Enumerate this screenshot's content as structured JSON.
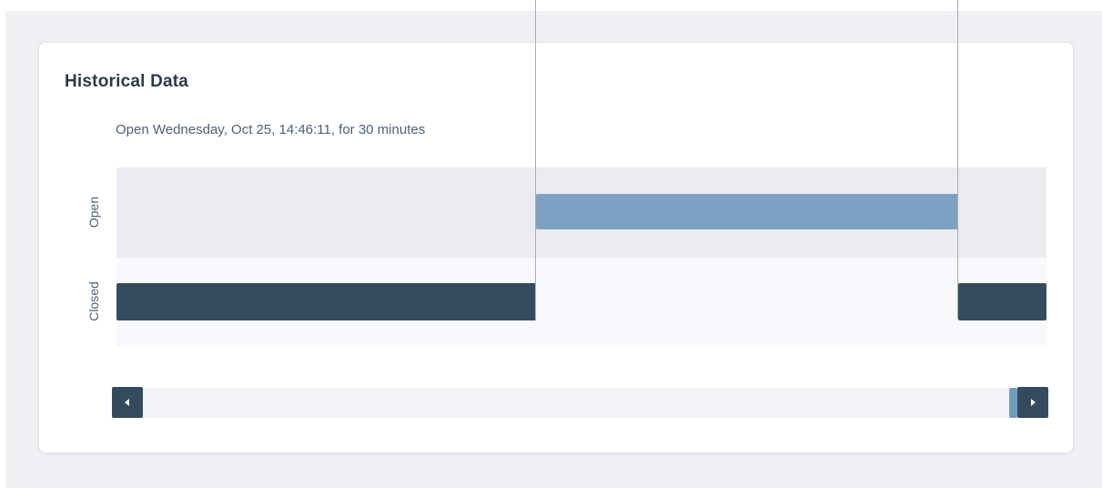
{
  "card": {
    "title": "Historical Data",
    "status_text": "Open Wednesday, Oct 25, 14:46:11, for 30 minutes"
  },
  "timeline": {
    "rows": [
      "Open",
      "Closed"
    ],
    "segments": [
      {
        "state": "Closed",
        "span": "start to 14:46:11"
      },
      {
        "state": "Open",
        "start": "14:46:11",
        "duration_minutes": 30
      },
      {
        "state": "Closed",
        "span": "after open period"
      }
    ],
    "colors": {
      "open": "#7ca3c4",
      "closed": "#344b5d",
      "open_band": "#ebecf0",
      "closed_band": "#f7f9fc",
      "marker_line": "#a9adb2"
    }
  },
  "scrollbar": {
    "left_icon": "caret-left-icon",
    "right_icon": "caret-right-icon",
    "position": 1.0
  }
}
